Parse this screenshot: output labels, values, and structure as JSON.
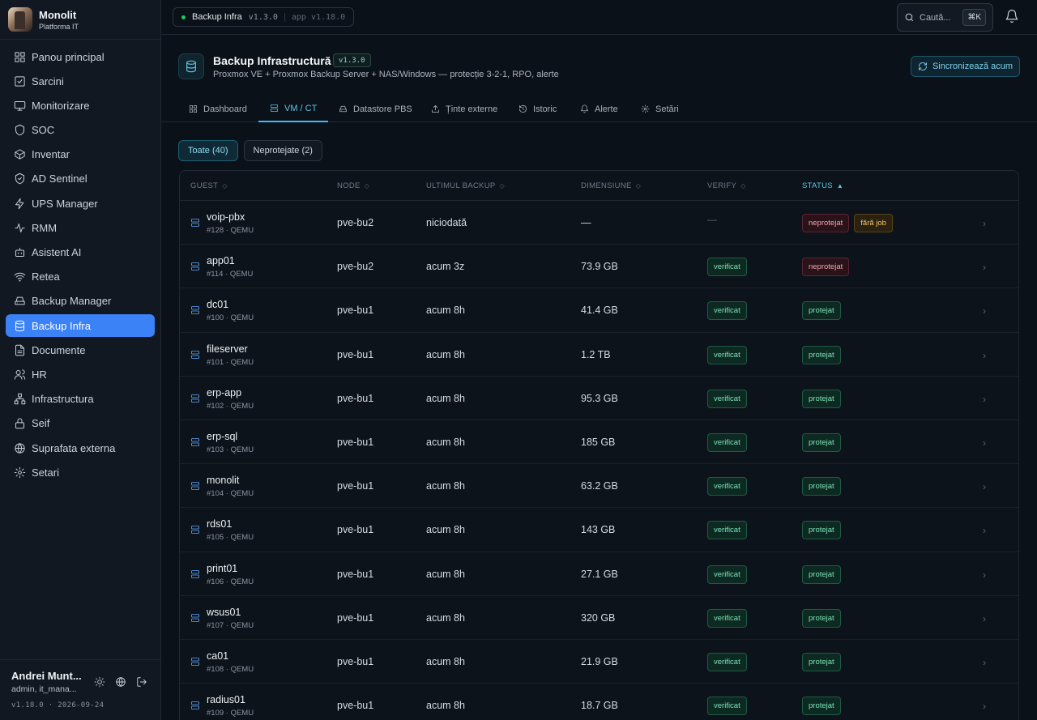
{
  "brand": {
    "title": "Monolit",
    "subtitle": "Platforma IT"
  },
  "sidebar": {
    "items": [
      {
        "label": "Panou principal",
        "icon": "grid-icon"
      },
      {
        "label": "Sarcini",
        "icon": "checkbox-icon"
      },
      {
        "label": "Monitorizare",
        "icon": "monitor-icon"
      },
      {
        "label": "SOC",
        "icon": "shield-icon"
      },
      {
        "label": "Inventar",
        "icon": "box-icon"
      },
      {
        "label": "AD Sentinel",
        "icon": "shield-check-icon"
      },
      {
        "label": "UPS Manager",
        "icon": "bolt-icon"
      },
      {
        "label": "RMM",
        "icon": "activity-icon"
      },
      {
        "label": "Asistent AI",
        "icon": "bot-icon"
      },
      {
        "label": "Retea",
        "icon": "wifi-icon"
      },
      {
        "label": "Backup Manager",
        "icon": "hdd-icon"
      },
      {
        "label": "Backup Infra",
        "icon": "database-icon",
        "active": true
      },
      {
        "label": "Documente",
        "icon": "file-icon"
      },
      {
        "label": "HR",
        "icon": "users-icon"
      },
      {
        "label": "Infrastructura",
        "icon": "network-icon"
      },
      {
        "label": "Seif",
        "icon": "lock-icon"
      },
      {
        "label": "Suprafata externa",
        "icon": "globe-icon"
      },
      {
        "label": "Setari",
        "icon": "gear-icon"
      }
    ]
  },
  "user": {
    "name": "Andrei Munt...",
    "role": "admin, it_mana...",
    "version": "v1.18.0 · 2026-09-24"
  },
  "topbar": {
    "crumb_label": "Backup Infra",
    "crumb_version": "v1.3.0",
    "app_version": "app v1.18.0",
    "search_placeholder": "Caută...",
    "search_shortcut": "⌘K"
  },
  "page": {
    "title": "Backup Infrastructură",
    "version": "v1.3.0",
    "subtitle": "Proxmox VE + Proxmox Backup Server + NAS/Windows — protecție 3-2-1, RPO, alerte",
    "sync_label": "Sincronizează acum"
  },
  "tabs": [
    {
      "label": "Dashboard",
      "icon": "grid-icon"
    },
    {
      "label": "VM / CT",
      "icon": "server-icon",
      "active": true
    },
    {
      "label": "Datastore PBS",
      "icon": "hdd-icon"
    },
    {
      "label": "Ținte externe",
      "icon": "upload-icon"
    },
    {
      "label": "Istoric",
      "icon": "history-icon"
    },
    {
      "label": "Alerte",
      "icon": "bell-icon"
    },
    {
      "label": "Setări",
      "icon": "gear-icon"
    }
  ],
  "filters": [
    {
      "label": "Toate (40)",
      "active": true
    },
    {
      "label": "Neprotejate (2)"
    }
  ],
  "table": {
    "columns": {
      "guest": "GUEST",
      "node": "NODE",
      "last": "ULTIMUL BACKUP",
      "size": "DIMENSIUNE",
      "verify": "VERIFY",
      "status": "STATUS"
    },
    "rows": [
      {
        "name": "voip-pbx",
        "sub": "#128 · QEMU",
        "node": "pve-bu2",
        "last": "niciodată",
        "size": "—",
        "verify": "—",
        "status": [
          "neprotejat",
          "fără job"
        ]
      },
      {
        "name": "app01",
        "sub": "#114 · QEMU",
        "node": "pve-bu2",
        "last": "acum 3z",
        "size": "73.9 GB",
        "verify": "verificat",
        "status": [
          "neprotejat"
        ]
      },
      {
        "name": "dc01",
        "sub": "#100 · QEMU",
        "node": "pve-bu1",
        "last": "acum 8h",
        "size": "41.4 GB",
        "verify": "verificat",
        "status": [
          "protejat"
        ]
      },
      {
        "name": "fileserver",
        "sub": "#101 · QEMU",
        "node": "pve-bu1",
        "last": "acum 8h",
        "size": "1.2 TB",
        "verify": "verificat",
        "status": [
          "protejat"
        ]
      },
      {
        "name": "erp-app",
        "sub": "#102 · QEMU",
        "node": "pve-bu1",
        "last": "acum 8h",
        "size": "95.3 GB",
        "verify": "verificat",
        "status": [
          "protejat"
        ]
      },
      {
        "name": "erp-sql",
        "sub": "#103 · QEMU",
        "node": "pve-bu1",
        "last": "acum 8h",
        "size": "185 GB",
        "verify": "verificat",
        "status": [
          "protejat"
        ]
      },
      {
        "name": "monolit",
        "sub": "#104 · QEMU",
        "node": "pve-bu1",
        "last": "acum 8h",
        "size": "63.2 GB",
        "verify": "verificat",
        "status": [
          "protejat"
        ]
      },
      {
        "name": "rds01",
        "sub": "#105 · QEMU",
        "node": "pve-bu1",
        "last": "acum 8h",
        "size": "143 GB",
        "verify": "verificat",
        "status": [
          "protejat"
        ]
      },
      {
        "name": "print01",
        "sub": "#106 · QEMU",
        "node": "pve-bu1",
        "last": "acum 8h",
        "size": "27.1 GB",
        "verify": "verificat",
        "status": [
          "protejat"
        ]
      },
      {
        "name": "wsus01",
        "sub": "#107 · QEMU",
        "node": "pve-bu1",
        "last": "acum 8h",
        "size": "320 GB",
        "verify": "verificat",
        "status": [
          "protejat"
        ]
      },
      {
        "name": "ca01",
        "sub": "#108 · QEMU",
        "node": "pve-bu1",
        "last": "acum 8h",
        "size": "21.9 GB",
        "verify": "verificat",
        "status": [
          "protejat"
        ]
      },
      {
        "name": "radius01",
        "sub": "#109 · QEMU",
        "node": "pve-bu1",
        "last": "acum 8h",
        "size": "18.7 GB",
        "verify": "verificat",
        "status": [
          "protejat"
        ]
      }
    ]
  },
  "colors": {
    "accent": "#3b82f6",
    "cyan": "#5ec8e4",
    "ok": "#7ee2b8",
    "danger": "#f4a3b3",
    "warn": "#f2c46b"
  }
}
